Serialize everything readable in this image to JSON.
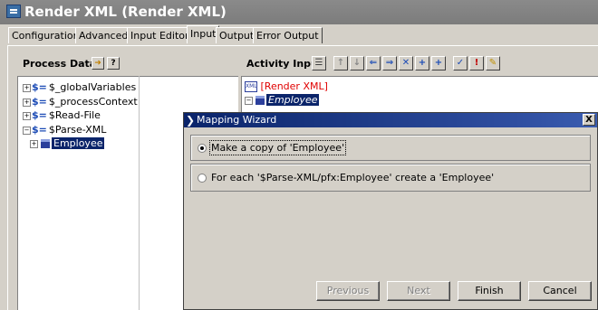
{
  "window": {
    "title": "Render XML (Render XML)"
  },
  "tabs": [
    "Configuration",
    "Advanced",
    "Input Editor",
    "Input",
    "Output",
    "Error Output"
  ],
  "active_tab": "Input",
  "process_data": {
    "title": "Process Data:",
    "tree": [
      {
        "label": "$_globalVariables",
        "expander": "+"
      },
      {
        "label": "$_processContext",
        "expander": "+"
      },
      {
        "label": "$Read-File",
        "expander": "+"
      },
      {
        "label": "$Parse-XML",
        "expander": "-"
      },
      {
        "label": "Employee",
        "expander": "+",
        "selected": true
      }
    ]
  },
  "activity_input": {
    "title": "Activity Input:",
    "root_label": "[Render XML]",
    "node_label": "Employee"
  },
  "wizard": {
    "title": "Mapping Wizard",
    "close_glyph": "X",
    "options": [
      {
        "label": "Make a copy of 'Employee'",
        "checked": true
      },
      {
        "label": "For each '$Parse-XML/pfx:Employee' create a 'Employee'",
        "checked": false
      }
    ],
    "buttons": {
      "previous": "Previous",
      "next": "Next",
      "finish": "Finish",
      "cancel": "Cancel"
    }
  },
  "colors": {
    "selection": "#0a246a",
    "title_gradient_start": "#0a246a",
    "root_label": "#e00000",
    "window_bg": "#d4d0c8"
  }
}
